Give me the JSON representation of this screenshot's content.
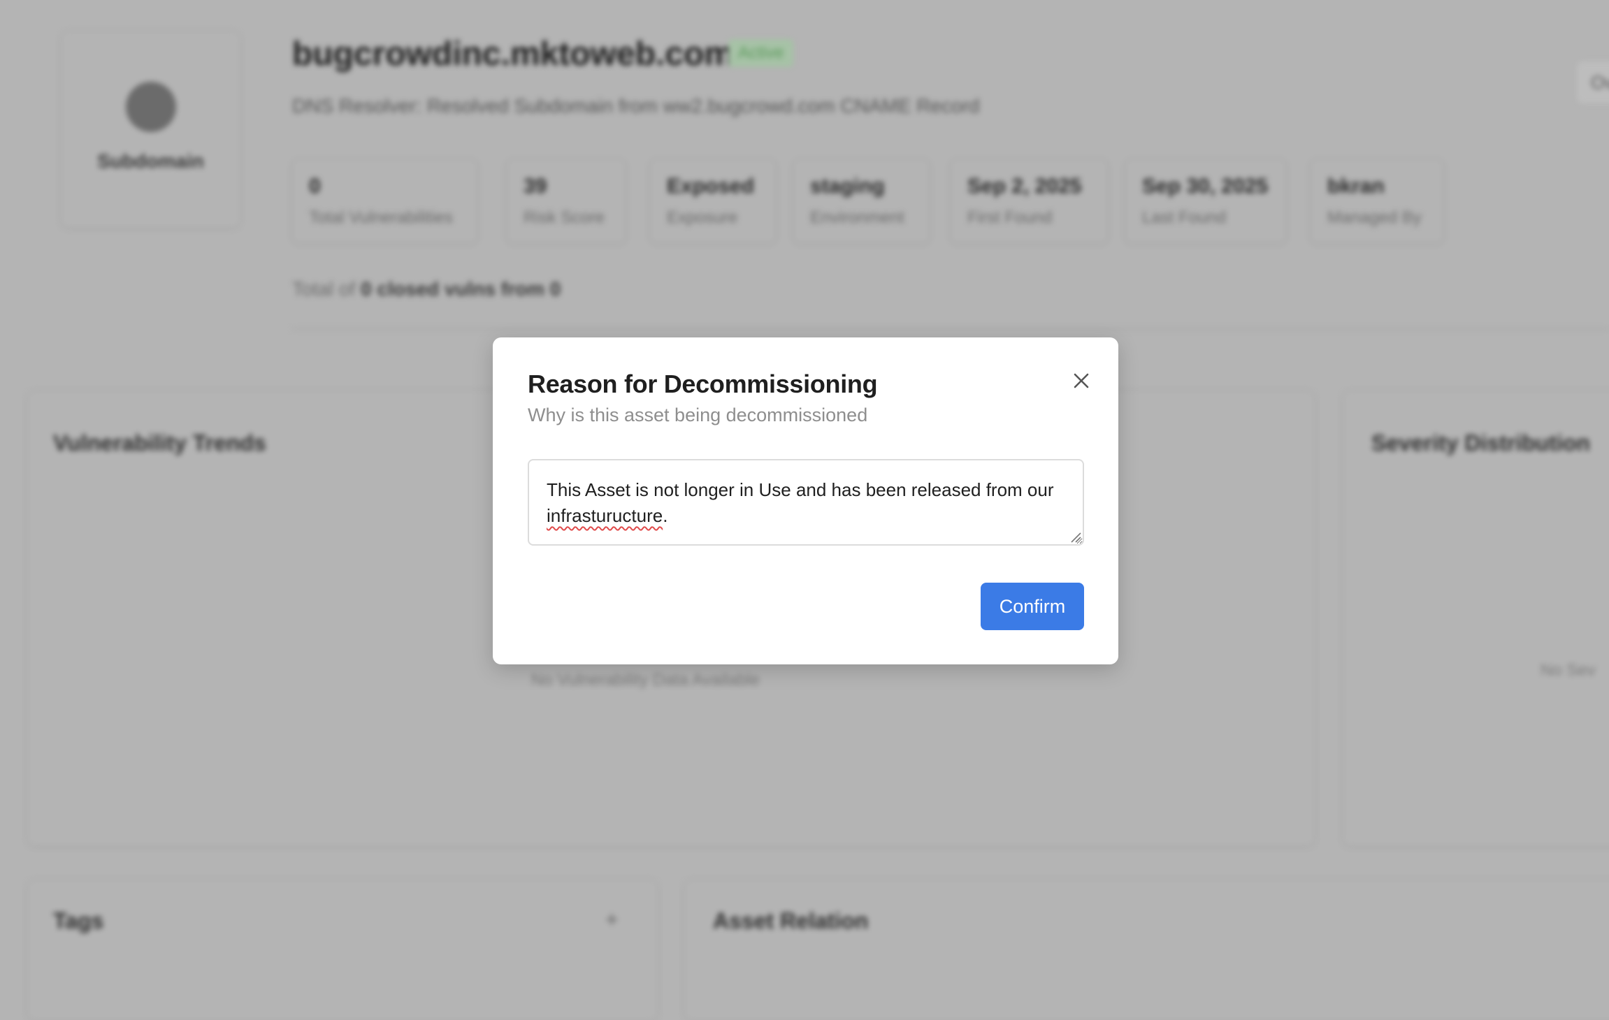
{
  "asset": {
    "type_label": "Subdomain",
    "title": "bugcrowdinc.mktoweb.com",
    "status": "Active",
    "subtitle": "DNS Resolver: Resolved Subdomain from ww2.bugcrowd.com CNAME Record",
    "top_right_button": "Ov"
  },
  "stats": [
    {
      "value": "0",
      "label": "Total Vulnerabilities"
    },
    {
      "value": "39",
      "label": "Risk Score"
    },
    {
      "value": "Exposed",
      "label": "Exposure"
    },
    {
      "value": "staging",
      "label": "Environment"
    },
    {
      "value": "Sep 2, 2025",
      "label": "First Found"
    },
    {
      "value": "Sep 30, 2025",
      "label": "Last Found"
    },
    {
      "value": "bkran",
      "label": "Managed By"
    }
  ],
  "total_line": {
    "prefix": "Total of",
    "emphasis": "0 closed vulns from 0"
  },
  "panels": {
    "trends_title": "Vulnerability Trends",
    "trends_empty": "No Vulnerability Data Available",
    "severity_title": "Severity Distribution",
    "severity_empty": "No Sev",
    "tags_title": "Tags",
    "tags_add": "+",
    "relation_title": "Asset Relation"
  },
  "modal": {
    "title": "Reason for Decommissioning",
    "subtitle": "Why is this asset being decommissioned",
    "reason_text_before": "This Asset is not longer in Use and has been released from our ",
    "reason_misspelled": "infrasturucture",
    "reason_text_after": ".",
    "confirm_label": "Confirm",
    "close_icon": "close-icon"
  },
  "colors": {
    "overlay": "#b4b4b4",
    "confirm": "#3b7be6",
    "badge_active": "#5b9a5b"
  }
}
